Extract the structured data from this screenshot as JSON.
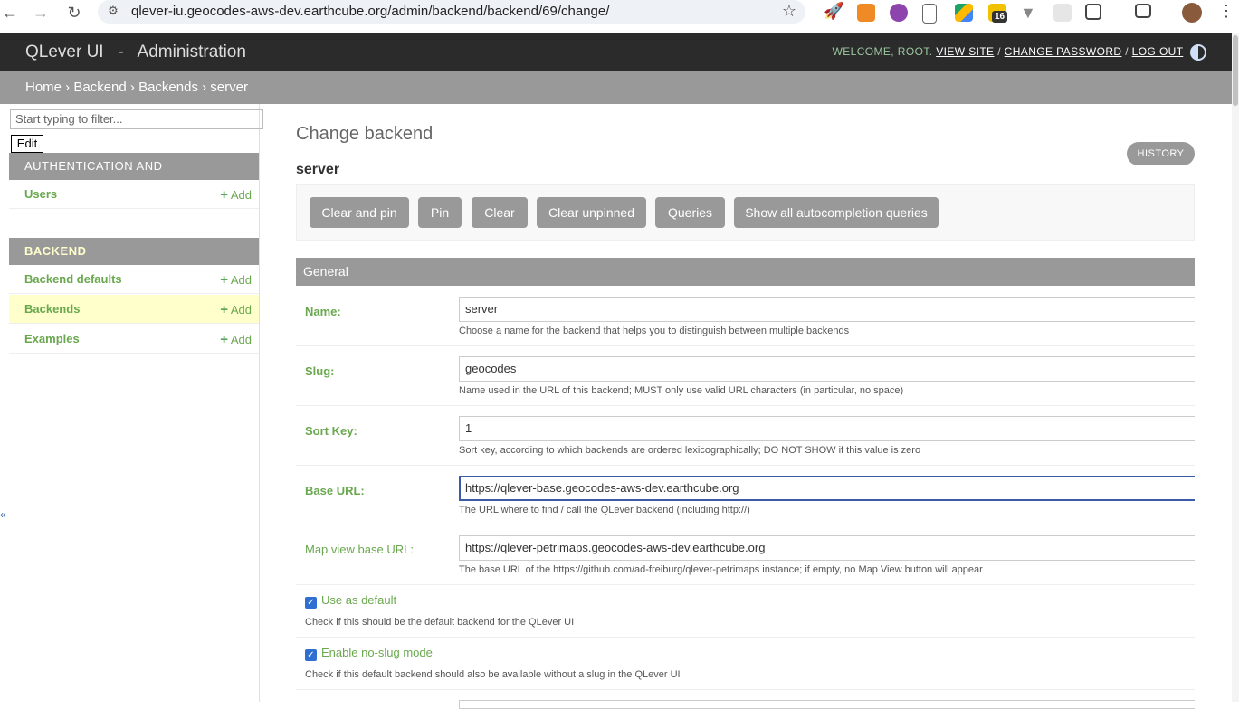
{
  "browser": {
    "url": "qlever-iu.geocodes-aws-dev.earthcube.org/admin/backend/backend/69/change/",
    "extension_badge": "16"
  },
  "header": {
    "brand": "QLever UI   -   Administration",
    "welcome": "WELCOME, ROOT.",
    "view_site": "VIEW SITE",
    "change_password": "CHANGE PASSWORD",
    "log_out": "LOG OUT",
    "separator": " / "
  },
  "breadcrumbs": {
    "home": "Home",
    "backend": "Backend",
    "backends": "Backends",
    "current": "server",
    "sep": " › "
  },
  "sidebar": {
    "filter_placeholder": "Start typing to filter...",
    "edit_label": "Edit",
    "sections": [
      {
        "title": "AUTHENTICATION AND AUTHORIZATION",
        "items": [
          {
            "label": "Users",
            "add": "Add"
          }
        ]
      },
      {
        "title": "BACKEND",
        "items": [
          {
            "label": "Backend defaults",
            "add": "Add"
          },
          {
            "label": "Backends",
            "add": "Add"
          },
          {
            "label": "Examples",
            "add": "Add"
          }
        ]
      }
    ]
  },
  "main": {
    "title": "Change backend",
    "object_name": "server",
    "history_label": "HISTORY",
    "toolbar": [
      "Clear and pin",
      "Pin",
      "Clear",
      "Clear unpinned",
      "Queries",
      "Show all autocompletion queries"
    ],
    "fieldset_title": "General",
    "fields": [
      {
        "label": "Name:",
        "value": "server",
        "help": "Choose a name for the backend that helps you to distinguish between multiple backends"
      },
      {
        "label": "Slug:",
        "value": "geocodes",
        "help": "Name used in the URL of this backend; MUST only use valid URL characters (in particular, no space)"
      },
      {
        "label": "Sort Key:",
        "value": "1",
        "help": "Sort key, according to which backends are ordered lexicographically; DO NOT SHOW if this value is zero"
      },
      {
        "label": "Base URL:",
        "value": "https://qlever-base.geocodes-aws-dev.earthcube.org",
        "help": "The URL where to find / call the QLever backend (including http://)"
      },
      {
        "label": "Map view base URL:",
        "value": "https://qlever-petrimaps.geocodes-aws-dev.earthcube.org",
        "help": "The base URL of the https://github.com/ad-freiburg/qlever-petrimaps instance; if empty, no Map View button will appear"
      }
    ],
    "checkboxes": [
      {
        "label": "Use as default",
        "checked": true,
        "help": "Check if this should be the default backend for the QLever UI"
      },
      {
        "label": "Enable no-slug mode",
        "checked": true,
        "help": "Check if this default backend should also be available without a slug in the QLever UI"
      }
    ]
  }
}
